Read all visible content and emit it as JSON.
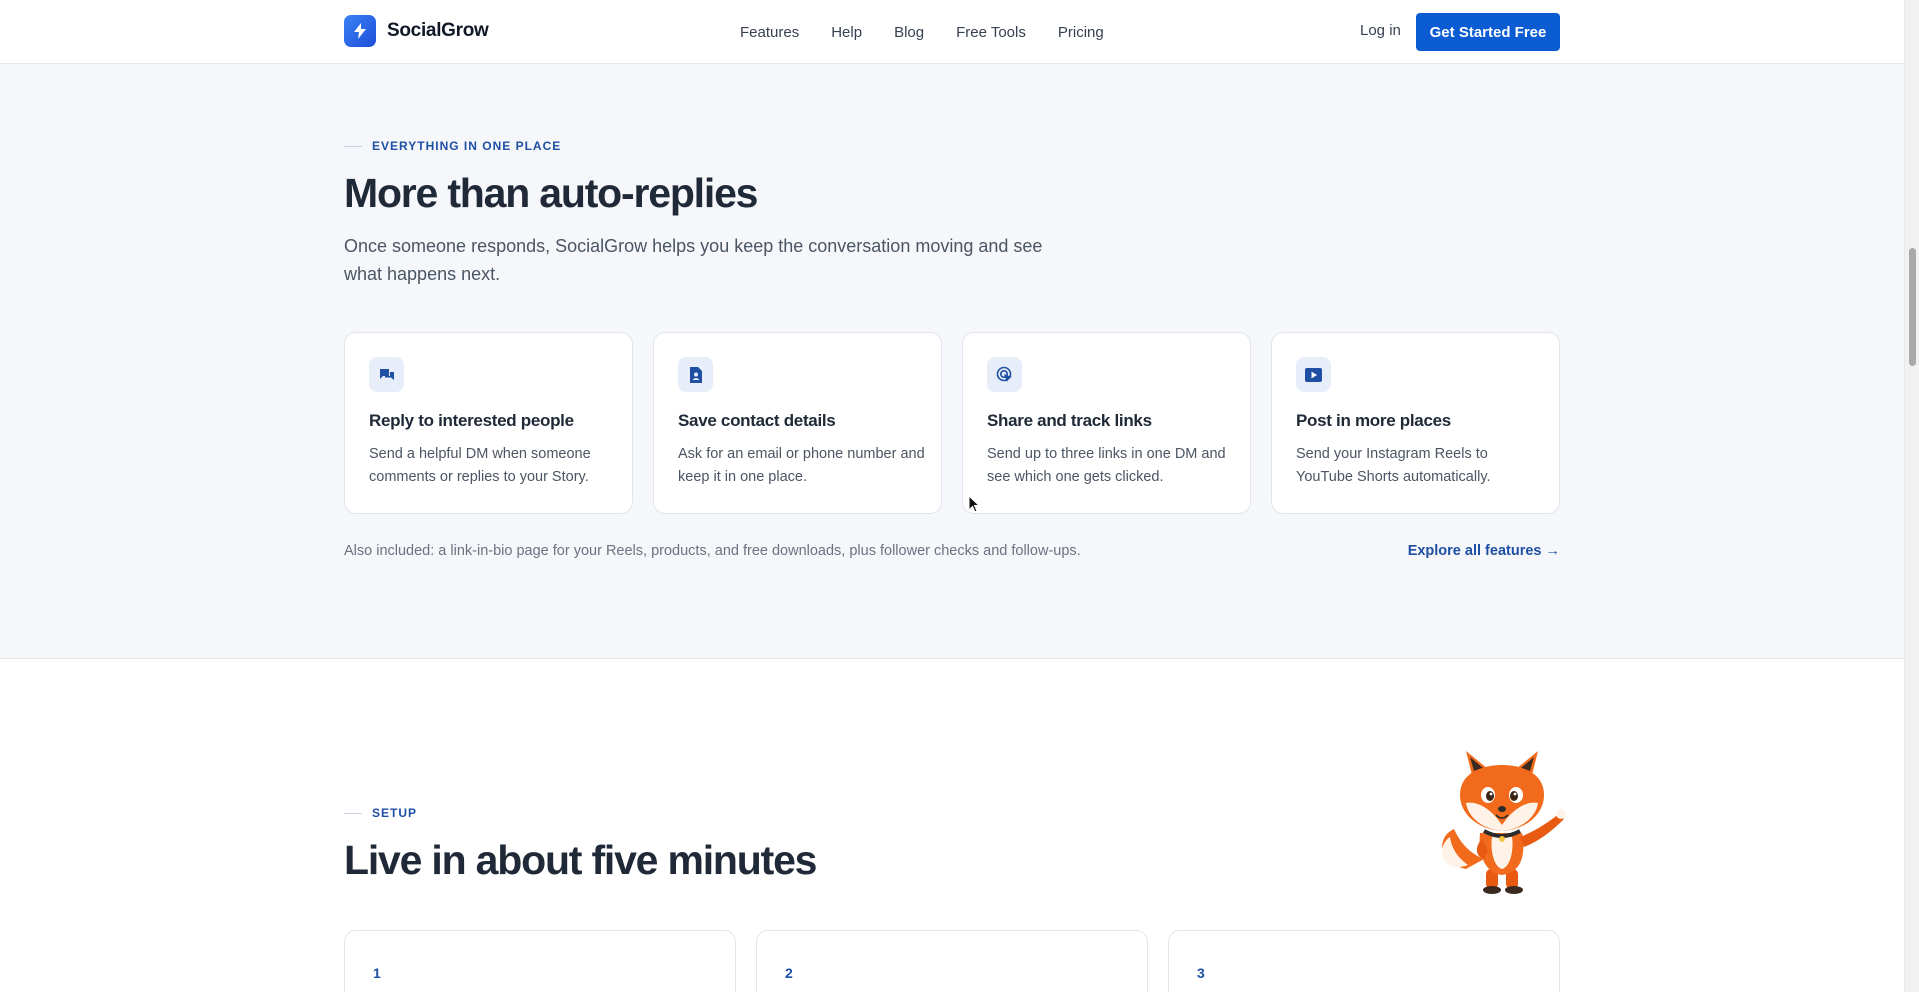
{
  "header": {
    "brand": "SocialGrow",
    "nav": [
      "Features",
      "Help",
      "Blog",
      "Free Tools",
      "Pricing"
    ],
    "login": "Log in",
    "cta": "Get Started Free"
  },
  "features": {
    "eyebrow": "EVERYTHING IN ONE PLACE",
    "title": "More than auto-replies",
    "lead": "Once someone responds, SocialGrow helps you keep the conversation moving and see what happens next.",
    "cards": [
      {
        "icon": "chat-bubbles-icon",
        "title": "Reply to interested people",
        "desc": "Send a helpful DM when someone comments or replies to your Story."
      },
      {
        "icon": "contact-card-icon",
        "title": "Save contact details",
        "desc": "Ask for an email or phone number and keep it in one place."
      },
      {
        "icon": "click-tracking-icon",
        "title": "Share and track links",
        "desc": "Send up to three links in one DM and see which one gets clicked."
      },
      {
        "icon": "video-play-icon",
        "title": "Post in more places",
        "desc": "Send your Instagram Reels to YouTube Shorts automatically."
      }
    ],
    "also": "Also included: a link-in-bio page for your Reels, products, and free downloads, plus follower checks and follow-ups.",
    "explore": "Explore all features →"
  },
  "setup": {
    "eyebrow": "SETUP",
    "title": "Live in about five minutes",
    "steps": [
      "1",
      "2",
      "3"
    ],
    "mascot": "fox-mascot-pointing"
  },
  "colors": {
    "accent": "#0b5bd3",
    "eyebrow": "#1e4fa3",
    "section_bg": "#f5f7fa"
  }
}
